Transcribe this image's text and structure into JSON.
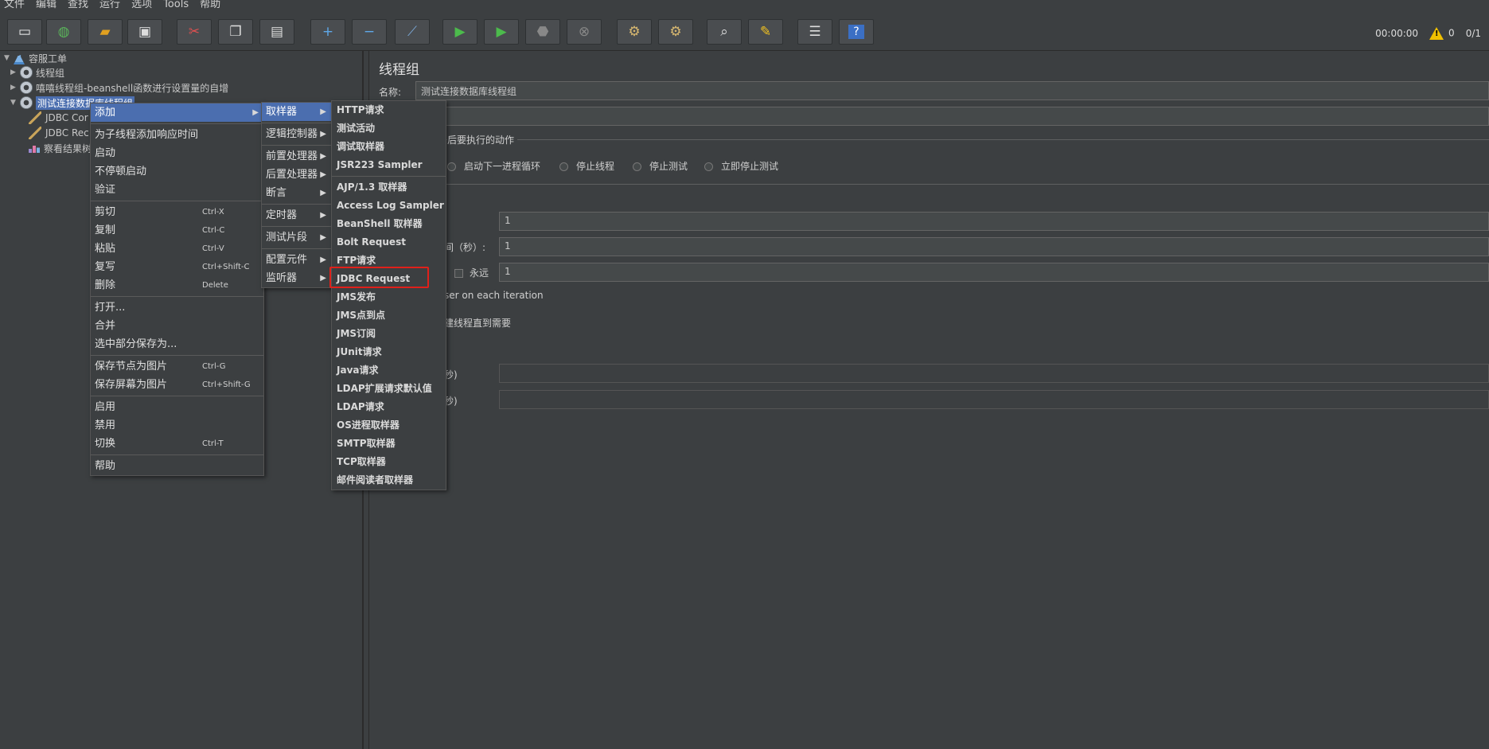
{
  "menubar": [
    "文件",
    "编辑",
    "查找",
    "运行",
    "选项",
    "Tools",
    "帮助"
  ],
  "toolbar": {
    "buttons": [
      {
        "name": "new-icon",
        "glyph": "▭",
        "color": "#f0f0f0"
      },
      {
        "name": "templates-icon",
        "glyph": "◍",
        "color": "#5ab35a"
      },
      {
        "name": "open-icon",
        "glyph": "▰",
        "color": "#e0a020"
      },
      {
        "name": "save-icon",
        "glyph": "▣",
        "color": "#dddddd"
      },
      {
        "name": "cut-icon",
        "glyph": "✂",
        "color": "#e05050"
      },
      {
        "name": "copy-icon",
        "glyph": "❐",
        "color": "#dddddd"
      },
      {
        "name": "paste-icon",
        "glyph": "▤",
        "color": "#dddddd"
      },
      {
        "name": "expand-icon",
        "glyph": "+",
        "color": "#5fa8e8"
      },
      {
        "name": "collapse-icon",
        "glyph": "−",
        "color": "#5fa8e8"
      },
      {
        "name": "toggle-icon",
        "glyph": "⟋",
        "color": "#7aa8d8"
      },
      {
        "name": "start-icon",
        "glyph": "▶",
        "color": "#4cbb4c"
      },
      {
        "name": "start-no-pause-icon",
        "glyph": "▶",
        "color": "#4cbb4c"
      },
      {
        "name": "stop-icon",
        "glyph": "⬣",
        "color": "#888888"
      },
      {
        "name": "shutdown-icon",
        "glyph": "⊗",
        "color": "#888888"
      },
      {
        "name": "clear-icon",
        "glyph": "⚙",
        "color": "#d8b870"
      },
      {
        "name": "clear-all-icon",
        "glyph": "⚙",
        "color": "#d8b870"
      },
      {
        "name": "search-icon",
        "glyph": "⌕",
        "color": "#dddddd"
      },
      {
        "name": "reset-search-icon",
        "glyph": "✎",
        "color": "#f0c020"
      },
      {
        "name": "function-helper-icon",
        "glyph": "☰",
        "color": "#dddddd"
      },
      {
        "name": "help-icon",
        "glyph": "?",
        "color": "#ffffff"
      }
    ],
    "timer": "00:00:00",
    "warning_count": "0",
    "thread_count": "0/1"
  },
  "tree": {
    "root": "容服工单",
    "items": [
      {
        "label": "线程组",
        "icon": "gear"
      },
      {
        "label": "嘻嘻线程组-beanshell函数进行设置量的自增",
        "icon": "gear"
      },
      {
        "label": "测试连接数据库线程组",
        "icon": "gear"
      },
      {
        "label": "JDBC Cor",
        "icon": "pencil"
      },
      {
        "label": "JDBC Rec",
        "icon": "pencil"
      },
      {
        "label": "察看结果树",
        "icon": "chart"
      }
    ]
  },
  "main": {
    "title": "线程组",
    "name_label": "名称:",
    "name_value": "测试连接数据库线程组",
    "action_header": "后要执行的动作",
    "radios": [
      "启动下一进程循环",
      "停止线程",
      "停止测试",
      "立即停止测试"
    ],
    "field_threads": "1",
    "rampup_label": "间（秒）:",
    "field_rampup": "1",
    "forever_label": "永远",
    "field_loops": "1",
    "same_user_text": "ser on each iteration",
    "delay_text": "建线程直到需要",
    "duration_label": "秒)",
    "startup_delay_label": "秒)"
  },
  "menu1": {
    "items": [
      {
        "label": "添加",
        "arrow": "▶",
        "selected": true
      },
      {
        "label": "为子线程添加响应时间",
        "sep_before": true
      },
      {
        "label": "启动"
      },
      {
        "label": "不停顿启动"
      },
      {
        "label": "验证"
      },
      {
        "label": "剪切",
        "shortcut": "Ctrl-X",
        "sep_before": true
      },
      {
        "label": "复制",
        "shortcut": "Ctrl-C"
      },
      {
        "label": "粘贴",
        "shortcut": "Ctrl-V"
      },
      {
        "label": "复写",
        "shortcut": "Ctrl+Shift-C"
      },
      {
        "label": "删除",
        "shortcut": "Delete"
      },
      {
        "label": "打开...",
        "sep_before": true
      },
      {
        "label": "合并"
      },
      {
        "label": "选中部分保存为..."
      },
      {
        "label": "保存节点为图片",
        "shortcut": "Ctrl-G",
        "sep_before": true
      },
      {
        "label": "保存屏幕为图片",
        "shortcut": "Ctrl+Shift-G"
      },
      {
        "label": "启用",
        "sep_before": true
      },
      {
        "label": "禁用"
      },
      {
        "label": "切换",
        "shortcut": "Ctrl-T"
      },
      {
        "label": "帮助",
        "sep_before": true
      }
    ]
  },
  "menu2": {
    "items": [
      {
        "label": "取样器",
        "arrow": "▶",
        "selected": true
      },
      {
        "label": "逻辑控制器",
        "arrow": "▶",
        "sep_before": true
      },
      {
        "label": "前置处理器",
        "arrow": "▶",
        "sep_before": true
      },
      {
        "label": "后置处理器",
        "arrow": "▶"
      },
      {
        "label": "断言",
        "arrow": "▶"
      },
      {
        "label": "定时器",
        "arrow": "▶",
        "sep_before": true
      },
      {
        "label": "测试片段",
        "arrow": "▶",
        "sep_before": true
      },
      {
        "label": "配置元件",
        "arrow": "▶",
        "sep_before": true
      },
      {
        "label": "监听器",
        "arrow": "▶"
      }
    ]
  },
  "menu3": {
    "items": [
      {
        "label": "HTTP请求"
      },
      {
        "label": "测试活动"
      },
      {
        "label": "调试取样器"
      },
      {
        "label": "JSR223 Sampler"
      },
      {
        "label": "AJP/1.3 取样器",
        "sep_before": true
      },
      {
        "label": "Access Log Sampler"
      },
      {
        "label": "BeanShell 取样器"
      },
      {
        "label": "Bolt Request"
      },
      {
        "label": "FTP请求"
      },
      {
        "label": "JDBC Request",
        "highlighted": true
      },
      {
        "label": "JMS发布"
      },
      {
        "label": "JMS点到点"
      },
      {
        "label": "JMS订阅"
      },
      {
        "label": "JUnit请求"
      },
      {
        "label": "Java请求"
      },
      {
        "label": "LDAP扩展请求默认值"
      },
      {
        "label": "LDAP请求"
      },
      {
        "label": "OS进程取样器"
      },
      {
        "label": "SMTP取样器"
      },
      {
        "label": "TCP取样器"
      },
      {
        "label": "邮件阅读者取样器"
      }
    ]
  },
  "colors": {
    "background": "#3c3f41",
    "selection": "#4b6eaf",
    "highlight_border": "#e0201a"
  }
}
